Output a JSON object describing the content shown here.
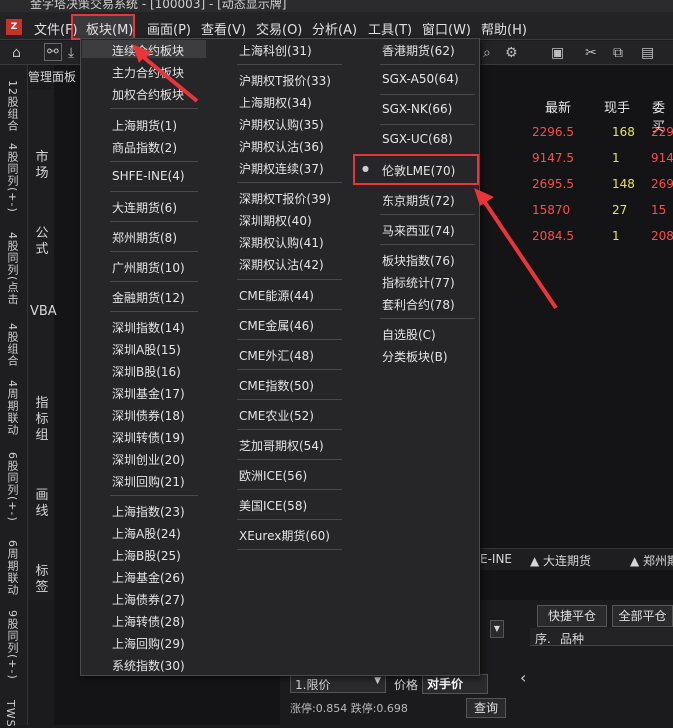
{
  "title_bar": {
    "text": "金字塔决策交易系统 - [100003] - [动态显示牌]"
  },
  "menu": {
    "items": [
      "文件(F)",
      "板块(M)",
      "画面(P)",
      "查看(V)",
      "交易(O)",
      "分析(A)",
      "工具(T)",
      "窗口(W)",
      "帮助(H)"
    ]
  },
  "left_strip": {
    "labels": [
      "12股组合",
      "4股同列(+-)",
      "4股同列(点击",
      "4股组合",
      "4周期联动",
      "6股同列(+-)",
      "6周期联动",
      "9股同列(+-)",
      "TWS"
    ]
  },
  "side_tabs": {
    "items": [
      "市场",
      "公式",
      "VBA",
      "指标组",
      "画线",
      "标签"
    ]
  },
  "panel": {
    "header": "管理面板"
  },
  "quote": {
    "headers": {
      "latest": "最新",
      "volume": "现手",
      "bid": "委买"
    },
    "rows": [
      {
        "latest": "2296.5",
        "volume": "168",
        "bid": "229"
      },
      {
        "latest": "9147.5",
        "volume": "1",
        "bid": "914"
      },
      {
        "latest": "2695.5",
        "volume": "148",
        "bid": "269"
      },
      {
        "latest": "15870",
        "volume": "27",
        "bid": "15"
      },
      {
        "latest": "2084.5",
        "volume": "1",
        "bid": "208"
      }
    ]
  },
  "bottom_tabs": [
    "E-INE",
    "▲ 大连期货",
    "▲ 郑州期"
  ],
  "order": {
    "quick_close": "快捷平仓",
    "close_all": "全部平仓",
    "col_seq": "序.",
    "col_name": "品种",
    "price_type": "1.限价",
    "price_label": "价格",
    "price_value": "对手价",
    "limits": "涨停:0.854 跌停:0.698",
    "query": "查询"
  },
  "dropdown": {
    "col1": [
      "连续合约板块",
      "主力合约板块",
      "加权合约板块",
      "上海期货(1)",
      "商品指数(2)",
      "SHFE-INE(4)",
      "大连期货(6)",
      "郑州期货(8)",
      "广州期货(10)",
      "金融期货(12)",
      "深圳指数(14)",
      "深圳A股(15)",
      "深圳B股(16)",
      "深圳基金(17)",
      "深圳债券(18)",
      "深圳转债(19)",
      "深圳创业(20)",
      "深圳回购(21)",
      "上海指数(23)",
      "上海A股(24)",
      "上海B股(25)",
      "上海基金(26)",
      "上海债券(27)",
      "上海转债(28)",
      "上海回购(29)",
      "系统指数(30)"
    ],
    "col2": [
      "上海科创(31)",
      "沪期权T报价(33)",
      "上海期权(34)",
      "沪期权认购(35)",
      "沪期权认沽(36)",
      "沪期权连续(37)",
      "深期权T报价(39)",
      "深圳期权(40)",
      "深期权认购(41)",
      "深期权认沽(42)",
      "CME能源(44)",
      "CME金属(46)",
      "CME外汇(48)",
      "CME指数(50)",
      "CME农业(52)",
      "芝加哥期权(54)",
      "欧洲ICE(56)",
      "美国ICE(58)",
      "XEurex期货(60)"
    ],
    "col3": [
      "香港期货(62)",
      "SGX-A50(64)",
      "SGX-NK(66)",
      "SGX-UC(68)",
      "伦敦LME(70)",
      "东京期货(72)",
      "马来西亚(74)",
      "板块指数(76)",
      "指标统计(77)",
      "套利合约(78)",
      "自选股(C)",
      "分类板块(B)"
    ]
  },
  "colors": {
    "highlight": "#e8353a",
    "up": "#ff4b4b",
    "volume": "#e6e64a"
  }
}
